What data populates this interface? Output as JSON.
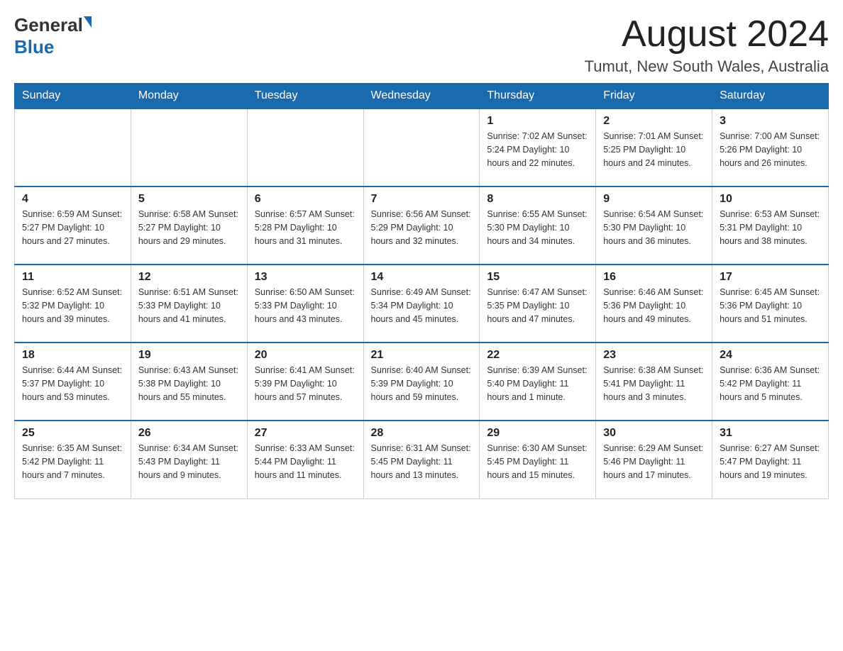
{
  "header": {
    "logo_general": "General",
    "logo_blue": "Blue",
    "main_title": "August 2024",
    "subtitle": "Tumut, New South Wales, Australia"
  },
  "calendar": {
    "days_of_week": [
      "Sunday",
      "Monday",
      "Tuesday",
      "Wednesday",
      "Thursday",
      "Friday",
      "Saturday"
    ],
    "weeks": [
      {
        "cells": [
          {
            "day": "",
            "info": ""
          },
          {
            "day": "",
            "info": ""
          },
          {
            "day": "",
            "info": ""
          },
          {
            "day": "",
            "info": ""
          },
          {
            "day": "1",
            "info": "Sunrise: 7:02 AM\nSunset: 5:24 PM\nDaylight: 10 hours\nand 22 minutes."
          },
          {
            "day": "2",
            "info": "Sunrise: 7:01 AM\nSunset: 5:25 PM\nDaylight: 10 hours\nand 24 minutes."
          },
          {
            "day": "3",
            "info": "Sunrise: 7:00 AM\nSunset: 5:26 PM\nDaylight: 10 hours\nand 26 minutes."
          }
        ]
      },
      {
        "cells": [
          {
            "day": "4",
            "info": "Sunrise: 6:59 AM\nSunset: 5:27 PM\nDaylight: 10 hours\nand 27 minutes."
          },
          {
            "day": "5",
            "info": "Sunrise: 6:58 AM\nSunset: 5:27 PM\nDaylight: 10 hours\nand 29 minutes."
          },
          {
            "day": "6",
            "info": "Sunrise: 6:57 AM\nSunset: 5:28 PM\nDaylight: 10 hours\nand 31 minutes."
          },
          {
            "day": "7",
            "info": "Sunrise: 6:56 AM\nSunset: 5:29 PM\nDaylight: 10 hours\nand 32 minutes."
          },
          {
            "day": "8",
            "info": "Sunrise: 6:55 AM\nSunset: 5:30 PM\nDaylight: 10 hours\nand 34 minutes."
          },
          {
            "day": "9",
            "info": "Sunrise: 6:54 AM\nSunset: 5:30 PM\nDaylight: 10 hours\nand 36 minutes."
          },
          {
            "day": "10",
            "info": "Sunrise: 6:53 AM\nSunset: 5:31 PM\nDaylight: 10 hours\nand 38 minutes."
          }
        ]
      },
      {
        "cells": [
          {
            "day": "11",
            "info": "Sunrise: 6:52 AM\nSunset: 5:32 PM\nDaylight: 10 hours\nand 39 minutes."
          },
          {
            "day": "12",
            "info": "Sunrise: 6:51 AM\nSunset: 5:33 PM\nDaylight: 10 hours\nand 41 minutes."
          },
          {
            "day": "13",
            "info": "Sunrise: 6:50 AM\nSunset: 5:33 PM\nDaylight: 10 hours\nand 43 minutes."
          },
          {
            "day": "14",
            "info": "Sunrise: 6:49 AM\nSunset: 5:34 PM\nDaylight: 10 hours\nand 45 minutes."
          },
          {
            "day": "15",
            "info": "Sunrise: 6:47 AM\nSunset: 5:35 PM\nDaylight: 10 hours\nand 47 minutes."
          },
          {
            "day": "16",
            "info": "Sunrise: 6:46 AM\nSunset: 5:36 PM\nDaylight: 10 hours\nand 49 minutes."
          },
          {
            "day": "17",
            "info": "Sunrise: 6:45 AM\nSunset: 5:36 PM\nDaylight: 10 hours\nand 51 minutes."
          }
        ]
      },
      {
        "cells": [
          {
            "day": "18",
            "info": "Sunrise: 6:44 AM\nSunset: 5:37 PM\nDaylight: 10 hours\nand 53 minutes."
          },
          {
            "day": "19",
            "info": "Sunrise: 6:43 AM\nSunset: 5:38 PM\nDaylight: 10 hours\nand 55 minutes."
          },
          {
            "day": "20",
            "info": "Sunrise: 6:41 AM\nSunset: 5:39 PM\nDaylight: 10 hours\nand 57 minutes."
          },
          {
            "day": "21",
            "info": "Sunrise: 6:40 AM\nSunset: 5:39 PM\nDaylight: 10 hours\nand 59 minutes."
          },
          {
            "day": "22",
            "info": "Sunrise: 6:39 AM\nSunset: 5:40 PM\nDaylight: 11 hours\nand 1 minute."
          },
          {
            "day": "23",
            "info": "Sunrise: 6:38 AM\nSunset: 5:41 PM\nDaylight: 11 hours\nand 3 minutes."
          },
          {
            "day": "24",
            "info": "Sunrise: 6:36 AM\nSunset: 5:42 PM\nDaylight: 11 hours\nand 5 minutes."
          }
        ]
      },
      {
        "cells": [
          {
            "day": "25",
            "info": "Sunrise: 6:35 AM\nSunset: 5:42 PM\nDaylight: 11 hours\nand 7 minutes."
          },
          {
            "day": "26",
            "info": "Sunrise: 6:34 AM\nSunset: 5:43 PM\nDaylight: 11 hours\nand 9 minutes."
          },
          {
            "day": "27",
            "info": "Sunrise: 6:33 AM\nSunset: 5:44 PM\nDaylight: 11 hours\nand 11 minutes."
          },
          {
            "day": "28",
            "info": "Sunrise: 6:31 AM\nSunset: 5:45 PM\nDaylight: 11 hours\nand 13 minutes."
          },
          {
            "day": "29",
            "info": "Sunrise: 6:30 AM\nSunset: 5:45 PM\nDaylight: 11 hours\nand 15 minutes."
          },
          {
            "day": "30",
            "info": "Sunrise: 6:29 AM\nSunset: 5:46 PM\nDaylight: 11 hours\nand 17 minutes."
          },
          {
            "day": "31",
            "info": "Sunrise: 6:27 AM\nSunset: 5:47 PM\nDaylight: 11 hours\nand 19 minutes."
          }
        ]
      }
    ]
  }
}
